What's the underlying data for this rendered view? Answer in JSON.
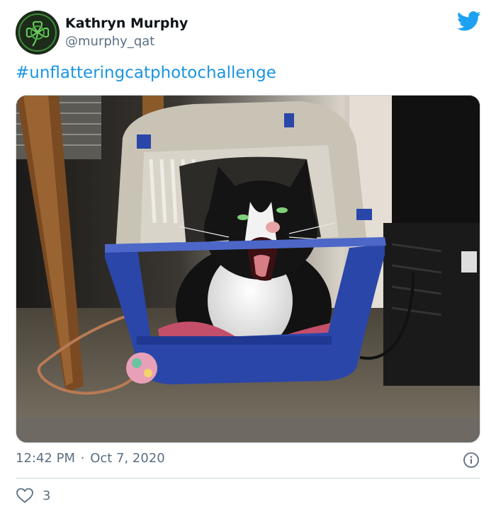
{
  "author": {
    "name": "Kathryn Murphy",
    "handle": "@murphy_qat",
    "avatar_icon": "shamrock-avatar-icon"
  },
  "tweet": {
    "text": "#unflatteringcatphotochallenge",
    "photo_description_icon": "cat-in-carrier-photo",
    "time": "12:42 PM",
    "separator": "·",
    "date": "Oct 7, 2020"
  },
  "actions": {
    "like_count": "3",
    "like_icon": "heart-icon",
    "info_icon": "info-icon"
  },
  "colors": {
    "link": "#1b95e0",
    "twitter_blue": "#1da1f2",
    "secondary_text": "#5b7083",
    "divider": "#cfd9de"
  }
}
